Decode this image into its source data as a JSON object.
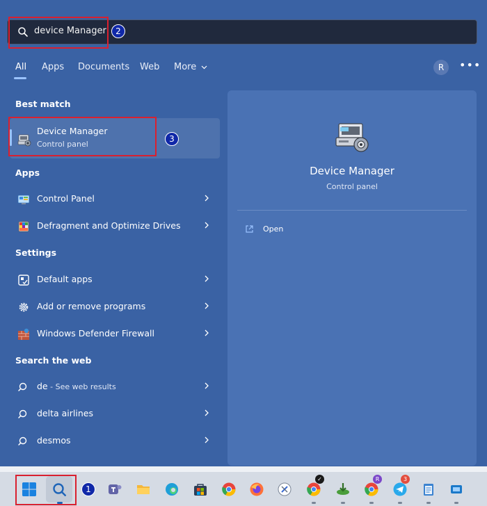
{
  "search": {
    "query": "device Manager"
  },
  "tabs": [
    {
      "label": "All"
    },
    {
      "label": "Apps"
    },
    {
      "label": "Documents"
    },
    {
      "label": "Web"
    },
    {
      "label": "More"
    }
  ],
  "header": {
    "avatar_initial": "R",
    "more_options": "•••"
  },
  "best_match": {
    "heading": "Best match",
    "item": {
      "label": "Device Manager",
      "sub": "Control panel"
    }
  },
  "apps": {
    "heading": "Apps",
    "items": [
      {
        "label": "Control Panel"
      },
      {
        "label": "Defragment and Optimize Drives"
      }
    ]
  },
  "settings": {
    "heading": "Settings",
    "items": [
      {
        "label": "Default apps"
      },
      {
        "label": "Add or remove programs"
      },
      {
        "label": "Windows Defender Firewall"
      }
    ]
  },
  "web": {
    "heading": "Search the web",
    "items": [
      {
        "label": "de",
        "hint": " - See web results"
      },
      {
        "label": "delta airlines"
      },
      {
        "label": "desmos"
      }
    ]
  },
  "preview": {
    "title": "Device Manager",
    "sub": "Control panel",
    "actions": [
      {
        "label": "Open"
      }
    ]
  },
  "annotations": {
    "badge1": "1",
    "badge2": "2",
    "badge3": "3"
  },
  "taskbar": {
    "badges": {
      "telegram": "3",
      "chrome_profile": "R"
    }
  },
  "colors": {
    "panel_bg": "#3a62a4",
    "preview_bg": "#4a72b4",
    "accent": "#9bc3ff",
    "annotation_red": "#d9202f",
    "badge_blue": "#1028a8"
  }
}
